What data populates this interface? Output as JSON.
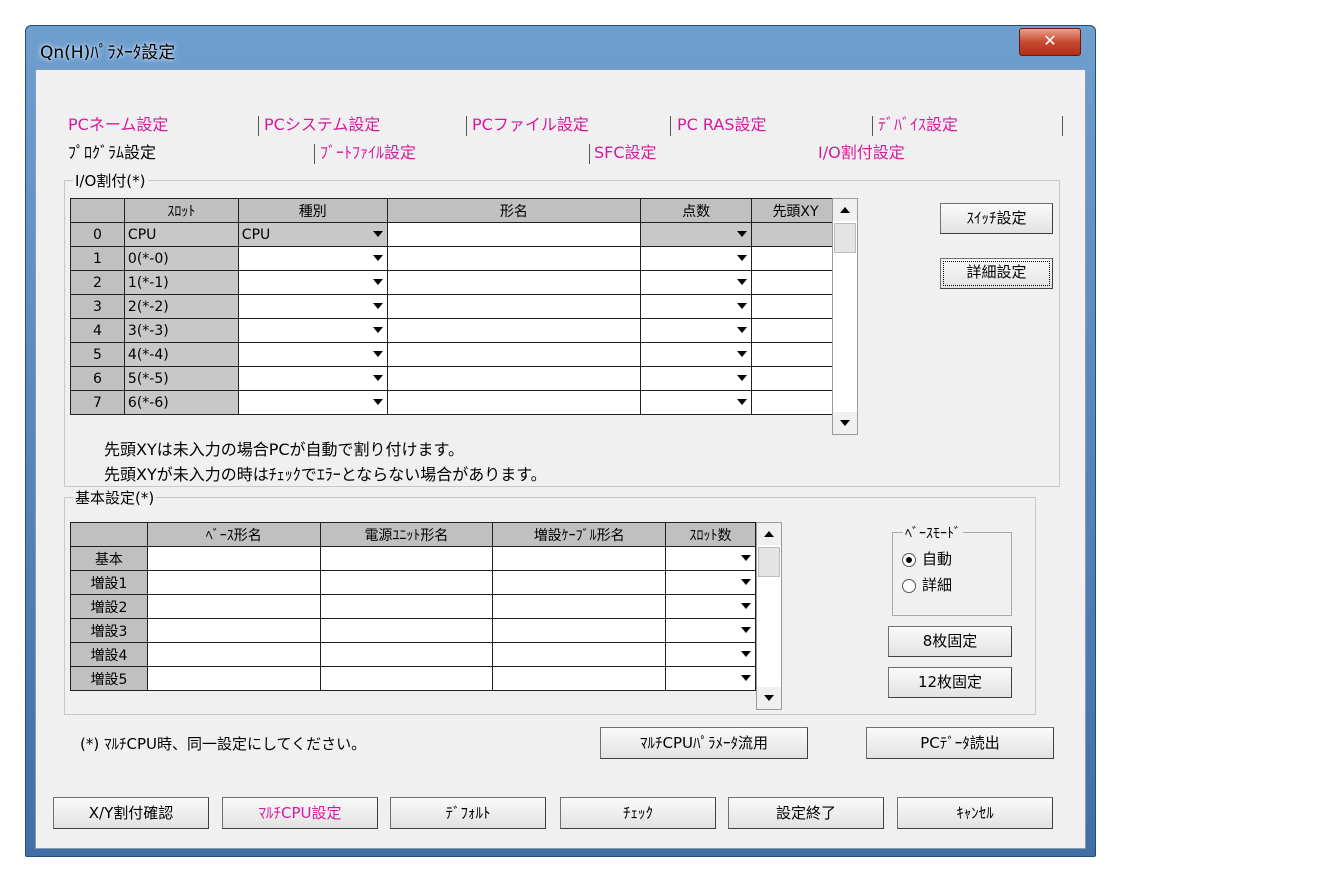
{
  "window": {
    "title": "Qn(H)ﾊﾟﾗﾒｰﾀ設定",
    "close_glyph": "✕"
  },
  "tabs": {
    "row1": [
      "PCネーム設定",
      "PCシステム設定",
      "PCファイル設定",
      "PC RAS設定",
      "ﾃﾞﾊﾞｲｽ設定"
    ],
    "row2": [
      "ﾌﾟﾛｸﾞﾗﾑ設定",
      "ﾌﾞｰﾄﾌｧｲﾙ設定",
      "SFC設定",
      "I/O割付設定"
    ]
  },
  "io": {
    "group_label": "I/O割付(*)",
    "columns": [
      "",
      "ｽﾛｯﾄ",
      "種別",
      "形名",
      "点数",
      "先頭XY"
    ],
    "rows": [
      {
        "no": "0",
        "slot": "CPU",
        "type": "CPU",
        "model": "",
        "points": "",
        "start": ""
      },
      {
        "no": "1",
        "slot": "0(*-0)",
        "type": "",
        "model": "",
        "points": "",
        "start": ""
      },
      {
        "no": "2",
        "slot": "1(*-1)",
        "type": "",
        "model": "",
        "points": "",
        "start": ""
      },
      {
        "no": "3",
        "slot": "2(*-2)",
        "type": "",
        "model": "",
        "points": "",
        "start": ""
      },
      {
        "no": "4",
        "slot": "3(*-3)",
        "type": "",
        "model": "",
        "points": "",
        "start": ""
      },
      {
        "no": "5",
        "slot": "4(*-4)",
        "type": "",
        "model": "",
        "points": "",
        "start": ""
      },
      {
        "no": "6",
        "slot": "5(*-5)",
        "type": "",
        "model": "",
        "points": "",
        "start": ""
      },
      {
        "no": "7",
        "slot": "6(*-6)",
        "type": "",
        "model": "",
        "points": "",
        "start": ""
      }
    ],
    "note1": "先頭XYは未入力の場合PCが自動で割り付けます。",
    "note2": "先頭XYが未入力の時はﾁｪｯｸでｴﾗｰとならない場合があります。",
    "switch_button": "ｽｲｯﾁ設定",
    "detail_button": "詳細設定"
  },
  "basic": {
    "group_label": "基本設定(*)",
    "columns": [
      "",
      "ﾍﾞｰｽ形名",
      "電源ﾕﾆｯﾄ形名",
      "増設ｹｰﾌﾞﾙ形名",
      "ｽﾛｯﾄ数"
    ],
    "rows": [
      {
        "label": "基本"
      },
      {
        "label": "増設1"
      },
      {
        "label": "増設2"
      },
      {
        "label": "増設3"
      },
      {
        "label": "増設4"
      },
      {
        "label": "増設5"
      }
    ],
    "base_mode": {
      "label": "ﾍﾞｰｽﾓｰﾄﾞ",
      "options": [
        "自動",
        "詳細"
      ],
      "selected": "自動"
    },
    "fix8_button": "8枚固定",
    "fix12_button": "12枚固定"
  },
  "multi": {
    "note": "(*) ﾏﾙﾁCPU時、同一設定にしてください。",
    "param_button": "ﾏﾙﾁCPUﾊﾟﾗﾒｰﾀ流用",
    "read_button": "PCﾃﾞｰﾀ読出"
  },
  "footer": {
    "xy_confirm": "X/Y割付確認",
    "multi_cpu": "ﾏﾙﾁCPU設定",
    "default": "ﾃﾞﾌｫﾙﾄ",
    "check": "ﾁｪｯｸ",
    "finish": "設定終了",
    "cancel": "ｷｬﾝｾﾙ"
  },
  "colors": {
    "accent": "#d6199e",
    "header_gray": "#c0c0c0"
  }
}
